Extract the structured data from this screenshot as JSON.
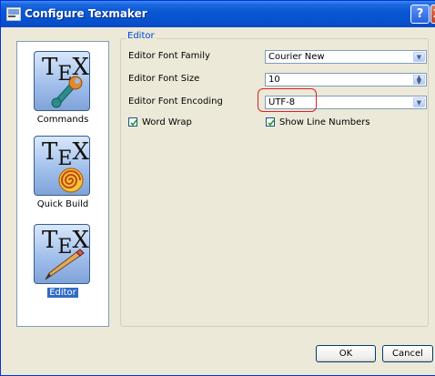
{
  "window": {
    "title": "Configure Texmaker",
    "help_label": "?",
    "close_label": "X"
  },
  "sidebar": {
    "items": [
      {
        "label": "Commands",
        "selected": false,
        "icon": "wrench-icon"
      },
      {
        "label": "Quick Build",
        "selected": false,
        "icon": "spiral-icon"
      },
      {
        "label": "Editor",
        "selected": true,
        "icon": "pencil-icon"
      }
    ],
    "logo_text": "TeX"
  },
  "editor": {
    "group_title": "Editor",
    "font_family": {
      "label": "Editor Font Family",
      "value": "Courier New"
    },
    "font_size": {
      "label": "Editor Font Size",
      "value": "10"
    },
    "font_encoding": {
      "label": "Editor Font Encoding",
      "value": "UTF-8"
    },
    "word_wrap": {
      "label": "Word Wrap",
      "checked": true
    },
    "show_line_numbers": {
      "label": "Show Line Numbers",
      "checked": true
    }
  },
  "buttons": {
    "ok": "OK",
    "cancel": "Cancel"
  },
  "colors": {
    "selection": "#316ac5",
    "highlight": "#e02020",
    "titlebar": "#0a57d3"
  }
}
